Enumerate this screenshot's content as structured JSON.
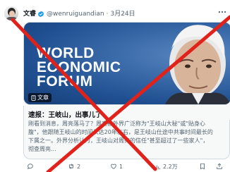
{
  "tweet": {
    "author_name": "文睿",
    "handle": "@wenruiguandian",
    "separator": "·",
    "date": "3月24日"
  },
  "card": {
    "image_text": [
      "WORLD",
      "ECONOMIC",
      "FORUM"
    ],
    "badge_label": "文章",
    "title": "速报：王岐山，出事儿了",
    "description_lines": [
      "刚看到消息，周亮落马了？周亮被外界广泛称为\"王岐山大秘\"或\"贴身心",
      "腹\"，他跟随王岐山的时间长达20年左右，是王岐山仕途中共事时间最长的",
      "下属之一。外界分析认为，王岐山对周亮的信任\"甚至超过了一些家人\"，",
      "彻查周亮..."
    ]
  },
  "actions": {
    "reply_count": "",
    "retweet_count": "2",
    "like_count": "1",
    "views_count": "2.2万"
  },
  "colors": {
    "verified": "#1d9bf0",
    "overlay_x": "#e0221b",
    "card_bg": "#1c4b8c"
  },
  "icons": [
    "verified-badge-icon",
    "more-icon",
    "document-icon",
    "reply-icon",
    "retweet-icon",
    "like-icon",
    "views-icon",
    "bookmark-icon",
    "share-icon"
  ]
}
